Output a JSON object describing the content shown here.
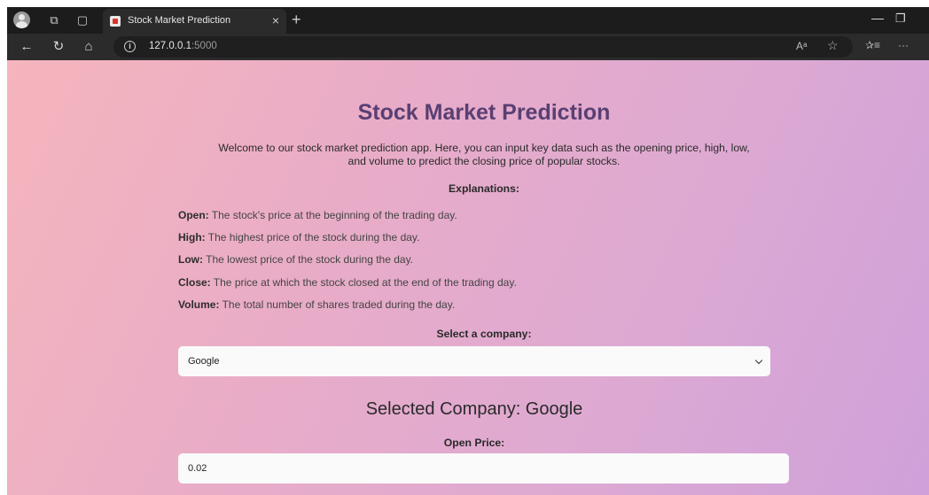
{
  "browser": {
    "tab_title": "Stock Market Prediction",
    "close_symbol": "×",
    "new_tab_symbol": "+",
    "url_host": "127.0.0.1",
    "url_port": ":5000",
    "read_aloud_glyph": "Aᵃ",
    "favorite_glyph": "☆",
    "favorites_glyph": "✰≡",
    "more_glyph": "···"
  },
  "page": {
    "title": "Stock Market Prediction",
    "intro_line1": "Welcome to our stock market prediction app. Here, you can input key data such as the opening price, high, low,",
    "intro_line2": "and volume to predict the closing price of popular stocks.",
    "explanations_heading": "Explanations:",
    "explanations": [
      {
        "term": "Open:",
        "text": " The stock's price at the beginning of the trading day."
      },
      {
        "term": "High:",
        "text": " The highest price of the stock during the day."
      },
      {
        "term": "Low:",
        "text": " The lowest price of the stock during the day."
      },
      {
        "term": "Close:",
        "text": " The price at which the stock closed at the end of the trading day."
      },
      {
        "term": "Volume:",
        "text": " The total number of shares traded during the day."
      }
    ],
    "select_label": "Select a company:",
    "selected_option": "Google",
    "selected_company_text": "Selected Company: Google",
    "open_price_label": "Open Price:",
    "open_price_value": "0.02"
  }
}
